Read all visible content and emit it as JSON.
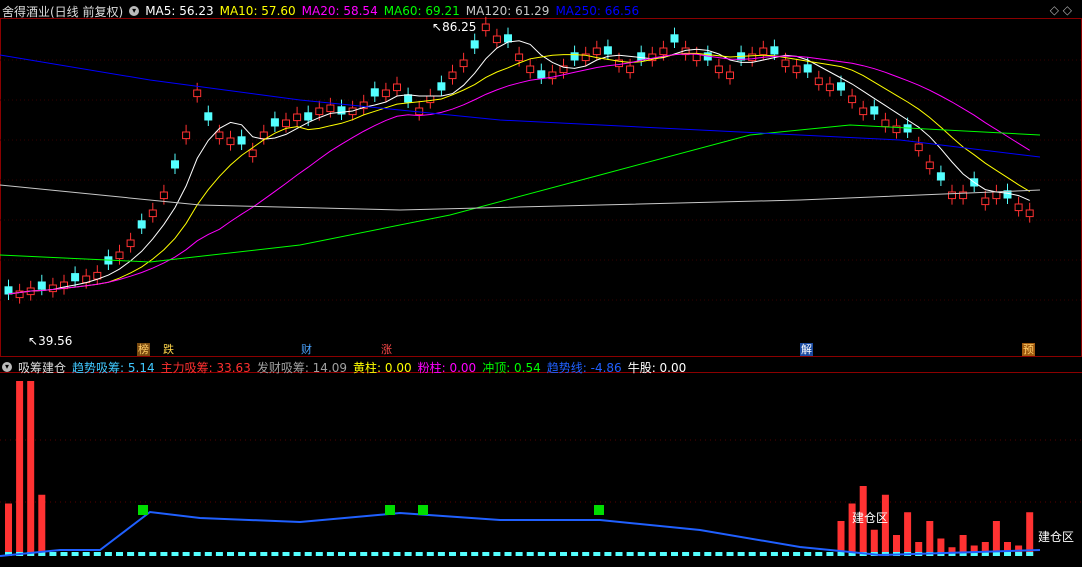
{
  "header": {
    "stock": "舍得酒业(日线 前复权)",
    "ma_items": [
      {
        "label": "MA5: 56.23",
        "color": "#ffffff"
      },
      {
        "label": "MA10: 57.60",
        "color": "#ffff00"
      },
      {
        "label": "MA20: 58.54",
        "color": "#ff00ff"
      },
      {
        "label": "MA60: 69.21",
        "color": "#00ff00"
      },
      {
        "label": "MA120: 61.29",
        "color": "#c8c8c8"
      },
      {
        "label": "MA250: 66.56",
        "color": "#0000ff"
      }
    ]
  },
  "price_labels": {
    "high": "86.25",
    "low": "39.56"
  },
  "events": [
    {
      "label": "榜",
      "bg": "#7a4a10",
      "color": "#ffcc66"
    },
    {
      "label": "跌",
      "bg": "#000000",
      "color": "#ffd54a"
    },
    {
      "label": "财",
      "bg": "#000000",
      "color": "#4aa3ff"
    },
    {
      "label": "涨",
      "bg": "#000000",
      "color": "#ff4a4a"
    },
    {
      "label": "解",
      "bg": "#1a4aa0",
      "color": "#ffffff"
    },
    {
      "label": "预",
      "bg": "#a05a10",
      "color": "#ffcc66"
    }
  ],
  "indicator": {
    "name": "吸筹建仓",
    "items": [
      {
        "label": "趋势吸筹: 5.14",
        "color": "#40c8ff"
      },
      {
        "label": "主力吸筹: 33.63",
        "color": "#ff3030"
      },
      {
        "label": "发财吸筹: 14.09",
        "color": "#a0a0a0"
      },
      {
        "label": "黄柱: 0.00",
        "color": "#ffff00"
      },
      {
        "label": "粉柱: 0.00",
        "color": "#ff00ff"
      },
      {
        "label": "冲顶: 0.54",
        "color": "#00ff00"
      },
      {
        "label": "趋势线: -4.86",
        "color": "#2060ff"
      },
      {
        "label": "牛股: 0.00",
        "color": "#ffffff"
      }
    ],
    "zone_label": "建仓区"
  },
  "colors": {
    "up": "#ff3232",
    "down": "#54ffff",
    "ma5": "#ffffff",
    "ma10": "#ffff00",
    "ma20": "#ff00ff",
    "ma60": "#00ff00",
    "ma120": "#c8c8c8",
    "ma250": "#0000ff",
    "trend": "#2060ff"
  }
}
